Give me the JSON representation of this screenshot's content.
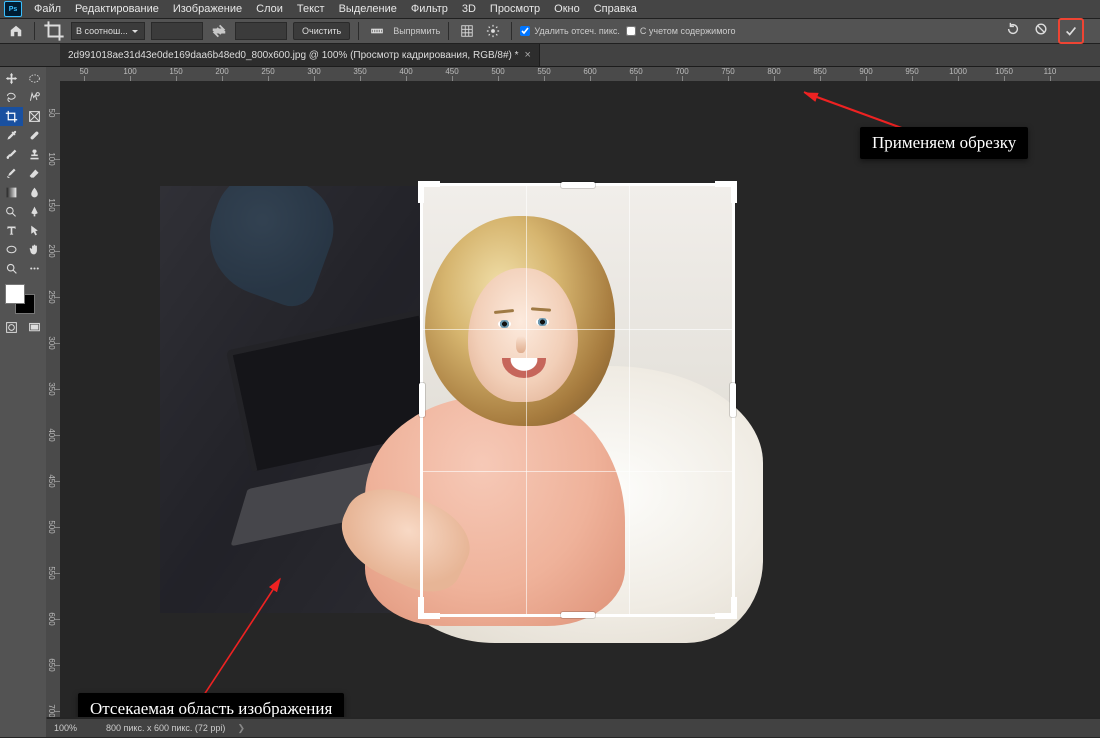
{
  "app": {
    "logo": "Ps"
  },
  "menu": {
    "items": [
      "Файл",
      "Редактирование",
      "Изображение",
      "Слои",
      "Текст",
      "Выделение",
      "Фильтр",
      "3D",
      "Просмотр",
      "Окно",
      "Справка"
    ]
  },
  "options": {
    "ratio_preset": "В соотнош...",
    "clear": "Очистить",
    "straighten": "Выпрямить",
    "delete_pixels": "Удалить отсеч. пикс.",
    "content_aware": "С учетом содержимого"
  },
  "tab": {
    "title": "2d991018ae31d43e0de169daa6b48ed0_800x600.jpg @ 100% (Просмотр кадрирования, RGB/8#) *"
  },
  "ruler": {
    "h": [
      "50",
      "100",
      "150",
      "200",
      "250",
      "300",
      "350",
      "400",
      "450",
      "500",
      "550",
      "600",
      "650",
      "700",
      "750",
      "800",
      "850",
      "900",
      "950",
      "1000",
      "1050",
      "110"
    ],
    "v": [
      "50",
      "100",
      "150",
      "200",
      "250",
      "300",
      "350",
      "400",
      "450",
      "500",
      "550",
      "600",
      "650",
      "700"
    ]
  },
  "status": {
    "zoom": "100%",
    "dims": "800 пикс. x 600 пикс. (72 ppi)"
  },
  "annot": {
    "right": "Применяем обрезку",
    "bottom": "Отсекаемая область изображения"
  }
}
